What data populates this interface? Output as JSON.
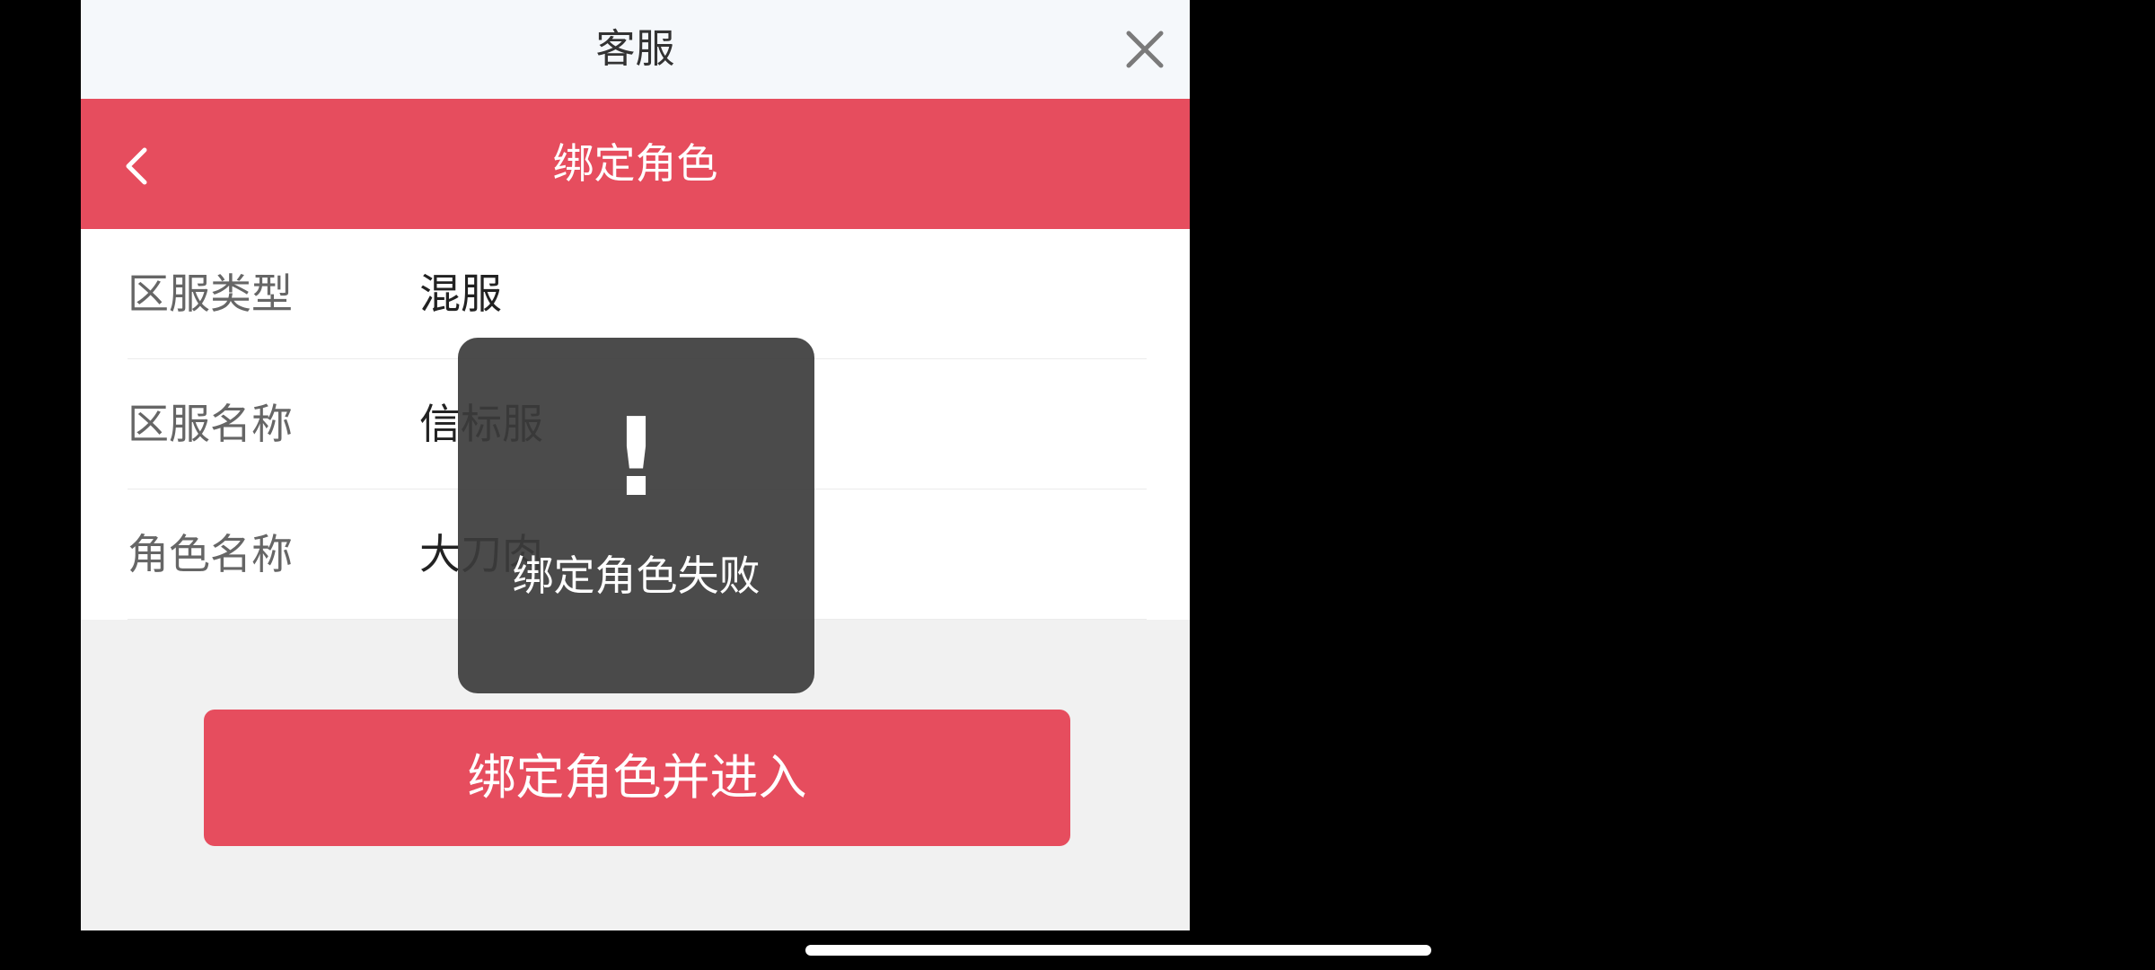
{
  "header": {
    "title": "客服",
    "close_icon": "close-icon"
  },
  "navbar": {
    "title": "绑定角色",
    "back_icon": "chevron-left-icon"
  },
  "form": {
    "rows": [
      {
        "label": "区服类型",
        "value": "混服"
      },
      {
        "label": "区服名称",
        "value": "信标服"
      },
      {
        "label": "角色名称",
        "value": "大刀肉"
      }
    ]
  },
  "actions": {
    "submit_label": "绑定角色并进入"
  },
  "toast": {
    "icon": "!",
    "message": "绑定角色失败"
  },
  "colors": {
    "accent": "#e64d5e",
    "background": "#f1f1f1",
    "topbar": "#f5f8fb"
  }
}
